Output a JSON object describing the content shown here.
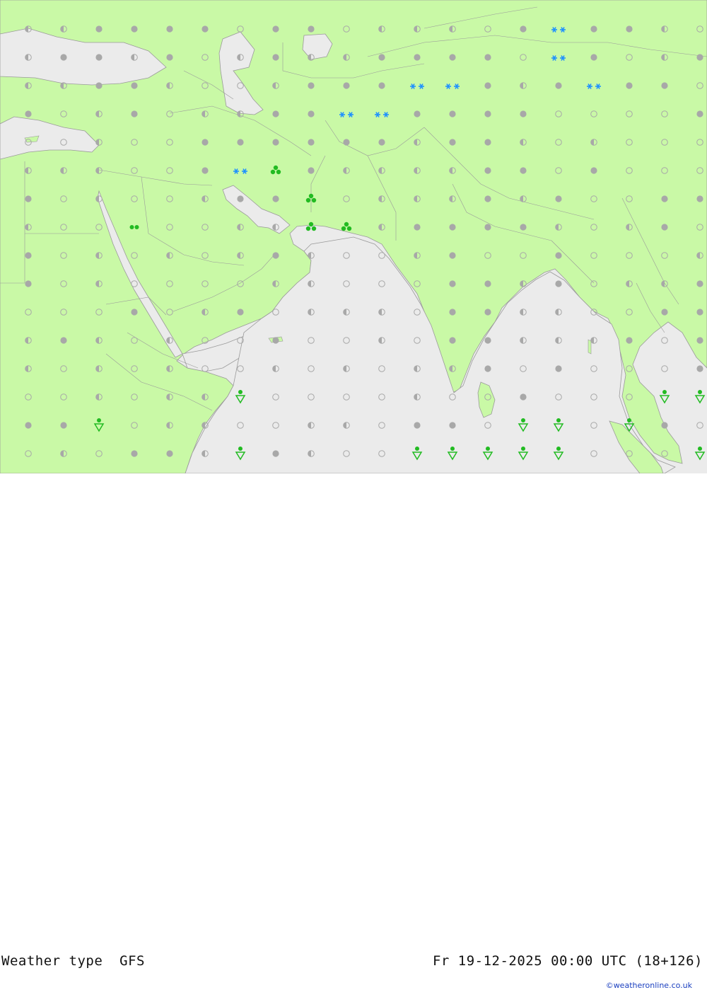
{
  "map": {
    "colors": {
      "land": "#c9f9a6",
      "sea": "#ebebeb",
      "border": "#9a9a9a",
      "cloudy": "#a8a8a8",
      "partly": "#a8a8a8",
      "rain": "#22bb22",
      "snow": "#1e90ff"
    },
    "legend_icons": {
      "o": "clear-icon",
      "h": "partly-cloudy-icon",
      "c": "cloudy-icon",
      "r": "rain-icon",
      "s": "snow-icon",
      "S": "heavy-snow-icon",
      "t": "thunder-rain-icon",
      "d": "showers-icon",
      "D": "drizzle-icon"
    },
    "grid_rows": [
      "hhccccoccohhhocSccho",
      "hcchcohchhccccoScohc",
      "hhcchoohcccSSchcScco",
      "cohcohhccSSccccooooc",
      "oohoocccccchcchohooo",
      "hhhoocSRchhhhccocooo",
      "cohoohccRohhhchcoocc",
      "hootoohhRRhcccchohco",
      "cohohohchoohcoocoooh",
      "cohoooohhooocchcohhc",
      "ooocohcohhhocchhoocc",
      "hchohooCoohocchhhcoc",
      "hohohoohohohhcocoooc",
      "oohohhdoooohoocooodd",
      "ccdohhoohhoccoDDoDco",
      "ohocchdchoodddddoooD",
      "ohchohdcdddcddddddco"
    ]
  },
  "footer": {
    "left_label": "Weather type  GFS",
    "right_label": "Fr 19-12-2025 00:00 UTC (18+126)",
    "credit": "©weatheronline.co.uk"
  }
}
